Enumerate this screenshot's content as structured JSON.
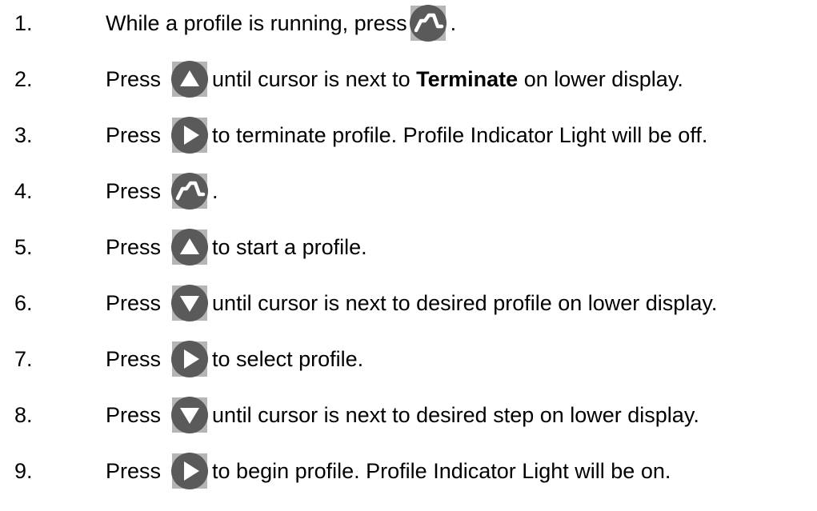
{
  "steps": [
    {
      "num": "1.",
      "before": "While a profile is running, press",
      "icon": "profile-icon",
      "after": ".",
      "bold": "",
      "after2": ""
    },
    {
      "num": "2.",
      "before": "Press",
      "icon": "up-arrow-icon",
      "after": "until cursor is next to",
      "bold": "Terminate",
      "after2": "on lower display."
    },
    {
      "num": "3.",
      "before": "Press",
      "icon": "right-arrow-icon",
      "after": "to terminate profile.  Profile Indicator Light will be off.",
      "bold": "",
      "after2": ""
    },
    {
      "num": "4.",
      "before": "Press",
      "icon": "profile-icon",
      "after": ".",
      "bold": "",
      "after2": ""
    },
    {
      "num": "5.",
      "before": "Press",
      "icon": "up-arrow-icon",
      "after": "to start a profile.",
      "bold": "",
      "after2": ""
    },
    {
      "num": "6.",
      "before": "Press",
      "icon": "down-arrow-icon",
      "after": "until cursor is next to desired profile on lower display.",
      "bold": "",
      "after2": ""
    },
    {
      "num": "7.",
      "before": "Press",
      "icon": "right-arrow-icon",
      "after": "to select profile.",
      "bold": "",
      "after2": ""
    },
    {
      "num": "8.",
      "before": "Press",
      "icon": "down-arrow-icon",
      "after": "until cursor is next to desired step on lower display.",
      "bold": "",
      "after2": ""
    },
    {
      "num": "9.",
      "before": "Press",
      "icon": "right-arrow-icon",
      "after": "to begin profile.  Profile Indicator Light will be on.",
      "bold": "",
      "after2": ""
    }
  ],
  "colors": {
    "button_bg": "#5a5a5a",
    "button_square": "#b5b5b5",
    "glyph": "#ffffff"
  }
}
